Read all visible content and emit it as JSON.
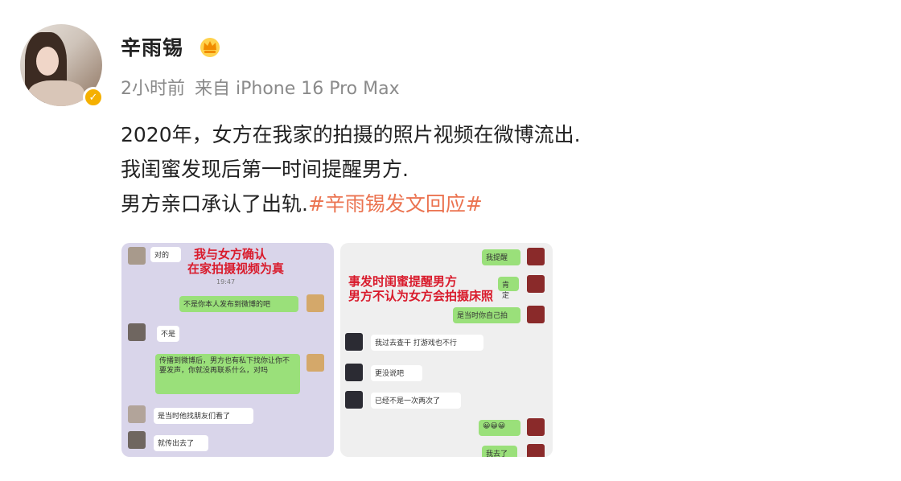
{
  "post": {
    "username": "辛雨锡",
    "time": "2小时前",
    "source": "来自 iPhone 16 Pro Max",
    "lines": [
      "2020年，女方在我家的拍摄的照片视频在微博流出.",
      "我闺蜜发现后第一时间提醒男方."
    ],
    "line3_text": "男方亲口承认了出轨.",
    "hashtag": "#辛雨锡发文回应#"
  },
  "images": {
    "left": {
      "caption_line1": "我与女方确认",
      "caption_line2": "在家拍摄视频为真",
      "time_stamp": "19:47",
      "msg1": "对的",
      "msg2": "不是你本人发布到微博的吧",
      "msg3": "不是",
      "msg4": "传播到微博后，男方也有私下找你让你不要发声，你就没再联系什么，对吗",
      "msg5": "是当时他找朋友们看了",
      "msg6": "就传出去了"
    },
    "right": {
      "caption_line1": "事发时闺蜜提醒男方",
      "caption_line2": "男方不认为女方会拍摄床照",
      "msg1": "我提醒",
      "msg2": "肯定",
      "msg3": "是当时你自己拍",
      "msg4": "我过去查干 打游戏也不行",
      "msg5": "更没说吧",
      "msg6": "已经不是一次两次了",
      "msg7": "😀😀😀",
      "msg8": "我去了"
    }
  },
  "colors": {
    "hashtag": "#eb7350",
    "badge": "#f5b000",
    "caption_red": "#d91b2c"
  },
  "icons": {
    "crown": "vip-crown-icon",
    "verify": "verified-badge-icon"
  }
}
